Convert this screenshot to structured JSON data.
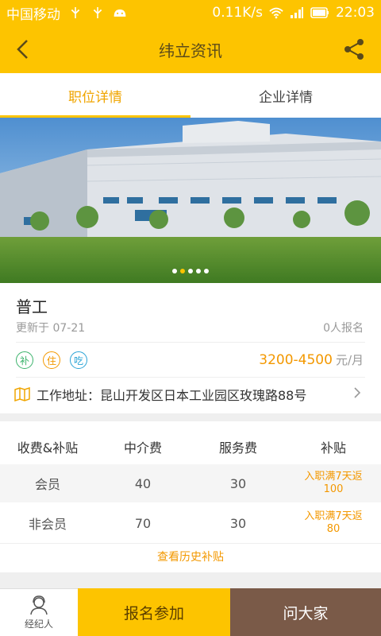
{
  "status_bar": {
    "carrier": "中国移动",
    "speed": "0.11K/s",
    "time": "22:03"
  },
  "header": {
    "title": "纬立资讯",
    "back_icon": "chevron-left-icon",
    "share_icon": "share-icon"
  },
  "tabs": [
    {
      "label": "职位详情",
      "active": true
    },
    {
      "label": "企业详情",
      "active": false
    }
  ],
  "banner": {
    "slide_count": 5,
    "active_index": 1
  },
  "job": {
    "title": "普工",
    "updated": "更新于 07-21",
    "signups": "0人报名",
    "tags": [
      {
        "label": "补",
        "color": "#3bb36b"
      },
      {
        "label": "住",
        "color": "#f39800"
      },
      {
        "label": "吃",
        "color": "#29a3d6"
      }
    ],
    "salary": "3200-4500",
    "salary_unit": "元/月",
    "address": "工作地址：昆山开发区日本工业园区玫瑰路88号"
  },
  "fees": {
    "headers": [
      "收费&补贴",
      "中介费",
      "服务费",
      "补贴"
    ],
    "rows": [
      {
        "type": "会员",
        "agency": "40",
        "service": "30",
        "subsidy_1": "入职满7天返",
        "subsidy_2": "100"
      },
      {
        "type": "非会员",
        "agency": "70",
        "service": "30",
        "subsidy_1": "入职满7天返",
        "subsidy_2": "80"
      }
    ],
    "history_link": "查看历史补贴"
  },
  "bottom": {
    "agent_label": "经纪人",
    "signup_label": "报名参加",
    "ask_label": "问大家"
  },
  "colors": {
    "brand_yellow": "#fdc400",
    "accent_orange": "#f39800",
    "ask_brown": "#7a5a48"
  }
}
